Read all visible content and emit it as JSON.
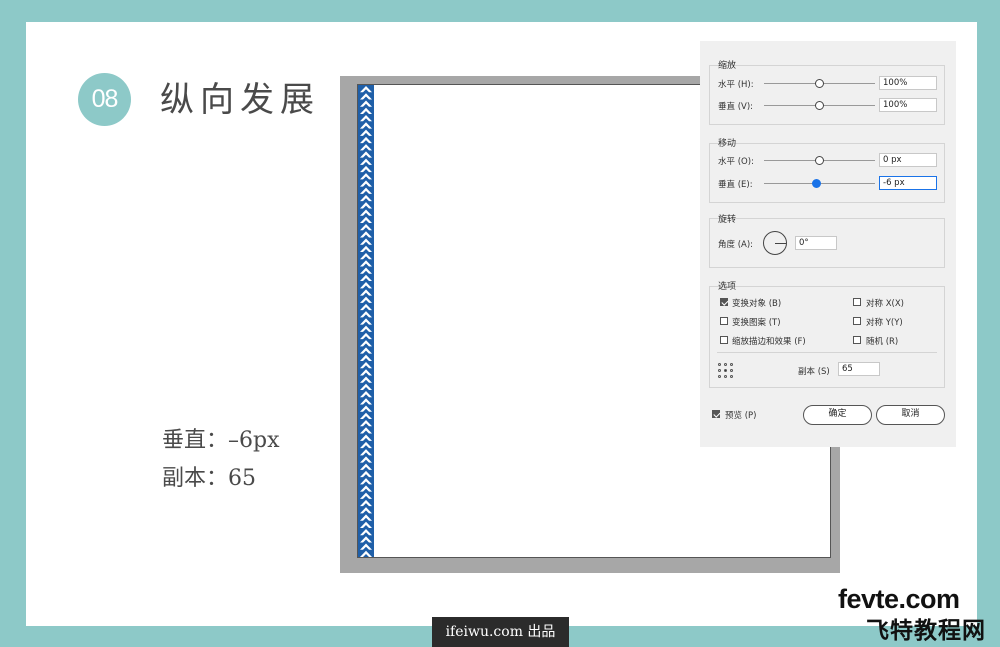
{
  "step": {
    "number": "08",
    "title": "纵向发展"
  },
  "captions": {
    "vertical": "垂直：–6px",
    "copies": "副本：65"
  },
  "dialog": {
    "scale": {
      "title": "缩放",
      "horizontal": {
        "label": "水平 (H):",
        "value": "100%",
        "slider": 0.5
      },
      "vertical": {
        "label": "垂直 (V):",
        "value": "100%",
        "slider": 0.5
      }
    },
    "move": {
      "title": "移动",
      "horizontal": {
        "label": "水平 (O):",
        "value": "0 px",
        "slider": 0.5
      },
      "vertical": {
        "label": "垂直 (E):",
        "value": "-6 px",
        "slider": 0.46
      }
    },
    "rotate": {
      "title": "旋转",
      "angle_label": "角度 (A):",
      "angle_value": "0°"
    },
    "options": {
      "title": "选项",
      "transform_objects": {
        "label": "变换对象 (B)",
        "checked": true
      },
      "transform_patterns": {
        "label": "变换图案 (T)",
        "checked": false
      },
      "scale_strokes": {
        "label": "缩放描边和效果 (F)",
        "checked": false
      },
      "reflect_x": {
        "label": "对称 X(X)",
        "checked": false
      },
      "reflect_y": {
        "label": "对称 Y(Y)",
        "checked": false
      },
      "random": {
        "label": "随机 (R)",
        "checked": false
      },
      "copies_label": "副本 (S)",
      "copies_value": "65"
    },
    "preview": {
      "label": "预览 (P)",
      "checked": true
    },
    "ok_label": "确定",
    "cancel_label": "取消"
  },
  "footer": {
    "badge": "ifeiwu.com 出品"
  },
  "brand": {
    "line1": "fevte.com",
    "line2": "飞特教程网"
  },
  "colors": {
    "teal": "#8dc9c8",
    "pattern_blue": "#1f5fa8",
    "accent": "#1a73e8",
    "brand_accent": "#e6221b"
  }
}
